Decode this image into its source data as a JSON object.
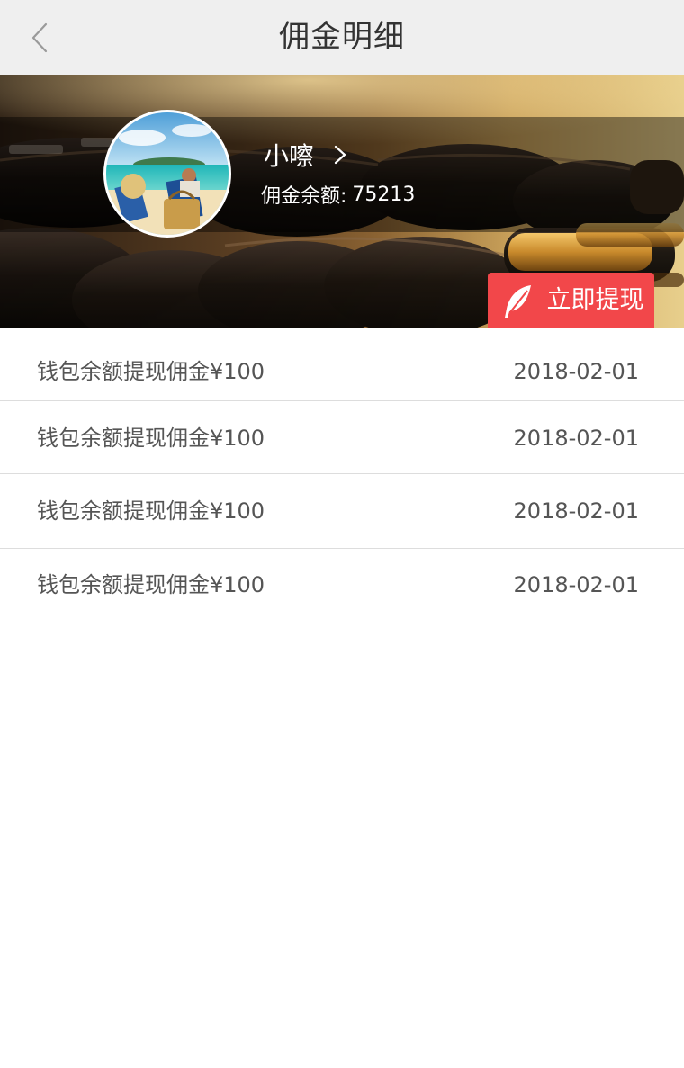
{
  "navbar": {
    "title": "佣金明细",
    "back_icon": "chevron-left-icon"
  },
  "profile": {
    "name": "小嚓",
    "arrow_icon": "chevron-right-icon",
    "balance_label": "佣金余额:",
    "balance_value": "75213",
    "avatar": "beach-avatar"
  },
  "withdraw": {
    "label": "立即提现",
    "icon": "feather-icon",
    "color": "#f2474a"
  },
  "records": [
    {
      "desc": "钱包余额提现佣金¥100",
      "date": "2018-02-01"
    },
    {
      "desc": "钱包余额提现佣金¥100",
      "date": "2018-02-01"
    },
    {
      "desc": "钱包余额提现佣金¥100",
      "date": "2018-02-01"
    },
    {
      "desc": "钱包余额提现佣金¥100",
      "date": "2018-02-01"
    }
  ]
}
